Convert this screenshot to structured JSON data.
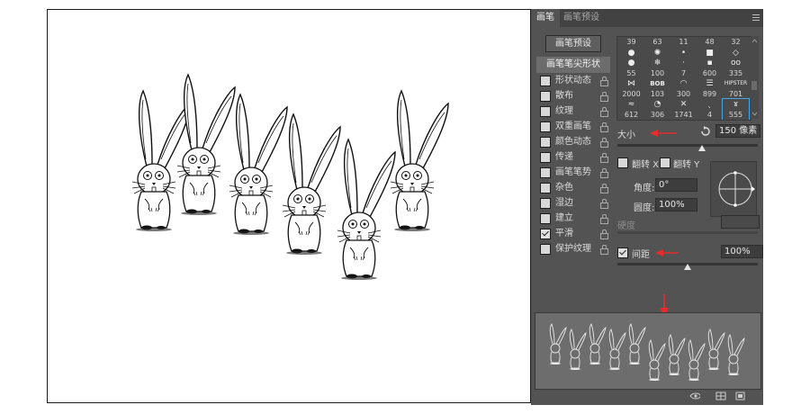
{
  "panel": {
    "tabs": [
      {
        "label": "画笔"
      },
      {
        "label": "画笔预设"
      }
    ],
    "presets_button": "画笔预设",
    "tip_shape_label": "画笔笔尖形状",
    "options": [
      {
        "label": "形状动态",
        "checked": false
      },
      {
        "label": "散布",
        "checked": false
      },
      {
        "label": "纹理",
        "checked": false
      },
      {
        "label": "双重画笔",
        "checked": false
      },
      {
        "label": "颜色动态",
        "checked": false
      },
      {
        "label": "传递",
        "checked": false
      },
      {
        "label": "画笔笔势",
        "checked": false
      },
      {
        "label": "杂色",
        "checked": false
      },
      {
        "label": "湿边",
        "checked": false
      },
      {
        "label": "建立",
        "checked": false
      },
      {
        "label": "平滑",
        "checked": true
      },
      {
        "label": "保护纹理",
        "checked": false
      }
    ],
    "brush_tips": [
      {
        "size": "39",
        "shape": "circle-soft"
      },
      {
        "size": "63",
        "shape": "splatter"
      },
      {
        "size": "11",
        "shape": "dot"
      },
      {
        "size": "48",
        "shape": "square"
      },
      {
        "size": "32",
        "shape": "diamond"
      },
      {
        "size": "55",
        "shape": "circle-hard"
      },
      {
        "size": "100",
        "shape": "snowflake"
      },
      {
        "size": "7",
        "shape": "small-dot"
      },
      {
        "size": "600",
        "shape": "square-gray"
      },
      {
        "size": "335",
        "shape": "glasses"
      },
      {
        "size": "2000",
        "shape": "bow"
      },
      {
        "size": "103",
        "shape": "bob-text"
      },
      {
        "size": "300",
        "shape": "lips"
      },
      {
        "size": "899",
        "shape": "moustache-glasses"
      },
      {
        "size": "701",
        "shape": "hipster-text"
      },
      {
        "size": "612",
        "shape": "moustache"
      },
      {
        "size": "306",
        "shape": "pacman"
      },
      {
        "size": "1741",
        "shape": "sketch"
      },
      {
        "size": "4",
        "shape": "tiny"
      },
      {
        "size": "555",
        "shape": "rabbit"
      }
    ],
    "selected_tip_index": 19,
    "hipster_text": "HIPSTER",
    "size_label": "大小",
    "size_value": "150 像素",
    "size_slider_fraction": 0.6,
    "flip_x_label": "翻转 X",
    "flip_y_label": "翻转 Y",
    "angle_label": "角度:",
    "angle_value": "0°",
    "roundness_label": "圆度:",
    "roundness_value": "100%",
    "hardness_label": "硬度",
    "spacing_label": "间距",
    "spacing_checked": true,
    "spacing_value": "100%",
    "spacing_slider_fraction": 0.5
  },
  "colors": {
    "panel_bg": "#535353",
    "accent_selection": "#4aa3df",
    "annotation_arrow": "#e52d2d"
  }
}
